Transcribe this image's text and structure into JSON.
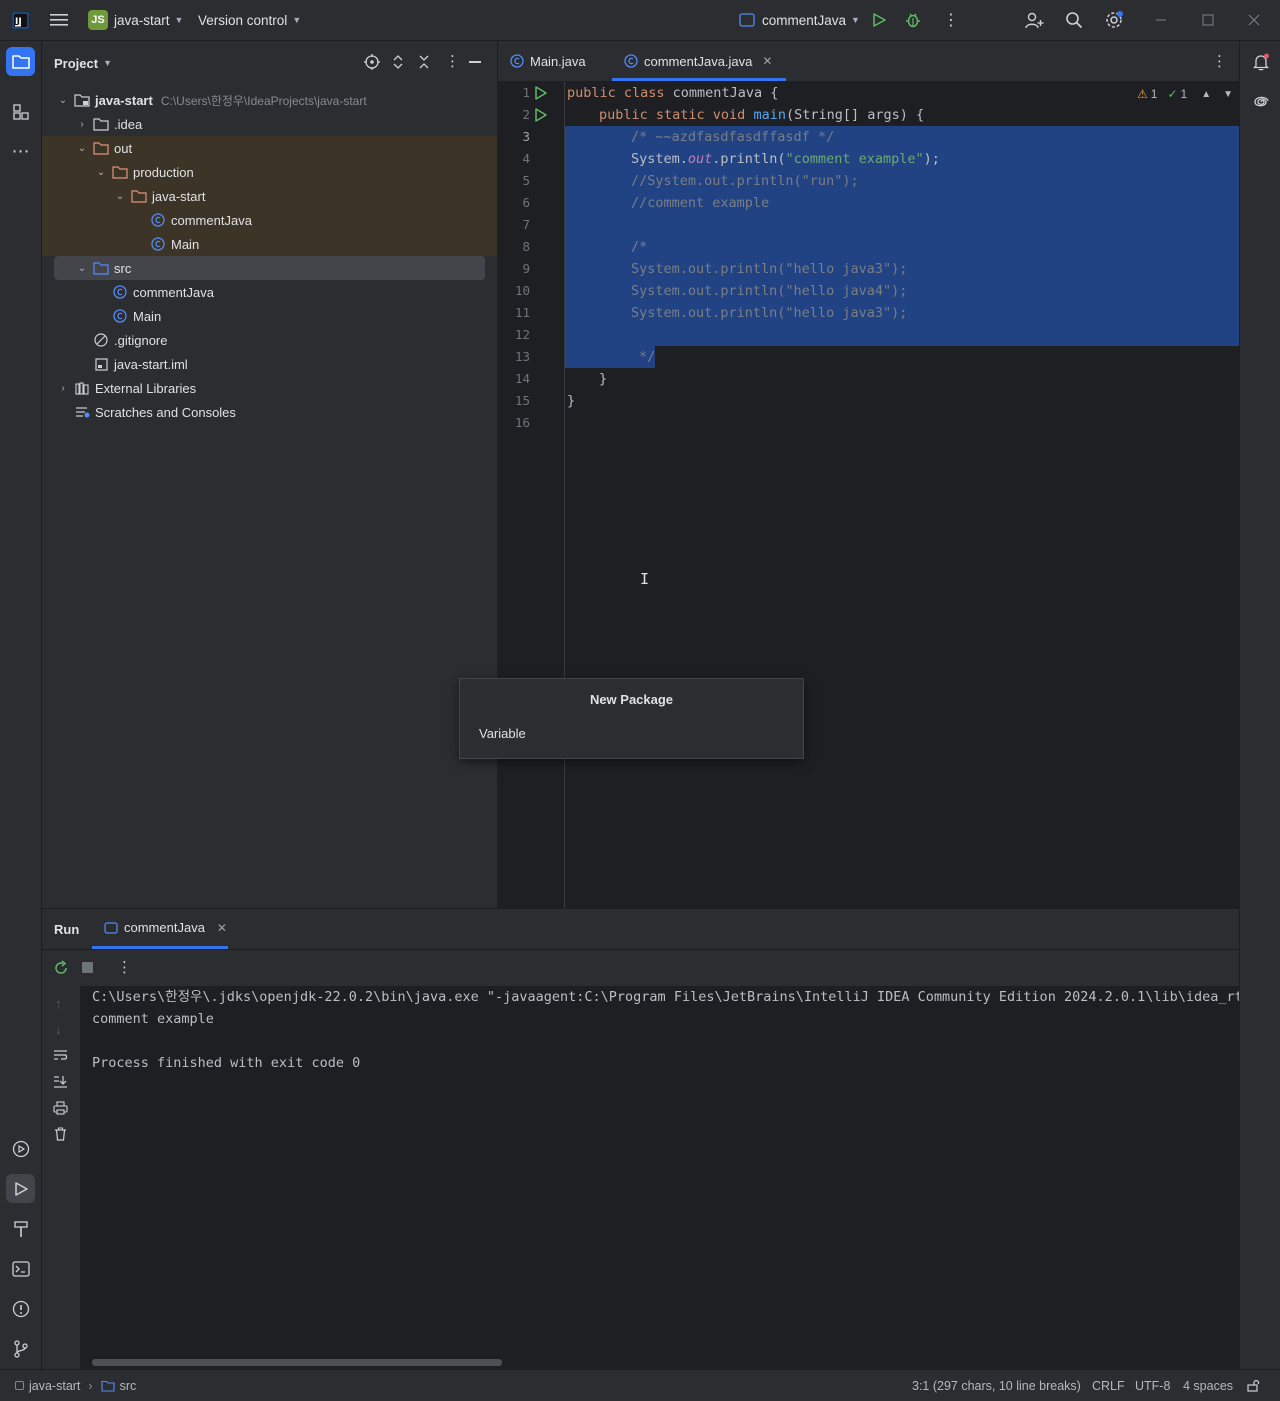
{
  "titlebar": {
    "project_badge": "JS",
    "project_name": "java-start",
    "vcs_label": "Version control",
    "run_config": "commentJava"
  },
  "project_panel": {
    "title": "Project",
    "tree": [
      {
        "label": "java-start",
        "hint": "C:\\Users\\한정우\\IdeaProjects\\java-start"
      },
      {
        "label": ".idea"
      },
      {
        "label": "out"
      },
      {
        "label": "production"
      },
      {
        "label": "java-start"
      },
      {
        "label": "commentJava"
      },
      {
        "label": "Main"
      },
      {
        "label": "src"
      },
      {
        "label": "commentJava"
      },
      {
        "label": "Main"
      },
      {
        "label": ".gitignore"
      },
      {
        "label": "java-start.iml"
      },
      {
        "label": "External Libraries"
      },
      {
        "label": "Scratches and Consoles"
      }
    ]
  },
  "editor": {
    "tabs": [
      {
        "label": "Main.java"
      },
      {
        "label": "commentJava.java"
      }
    ],
    "inspection": {
      "warnings": "1",
      "ok": "1"
    },
    "line_numbers": [
      "1",
      "2",
      "3",
      "4",
      "5",
      "6",
      "7",
      "8",
      "9",
      "10",
      "11",
      "12",
      "13",
      "14",
      "15",
      "16"
    ],
    "code": {
      "l1_kw": "public class ",
      "l1_rest": "commentJava {",
      "l2_kw": "public static void ",
      "l2_fn": "main",
      "l2_rest": "(String[] args) {",
      "l3": "/* ~~azdfasdfasdffasdf */",
      "l4_a": "System.",
      "l4_fld": "out",
      "l4_b": ".println(",
      "l4_str": "\"comment example\"",
      "l4_c": ");",
      "l5": "//System.out.println(\"run\");",
      "l6": "//comment example",
      "l8": "/*",
      "l9": "System.out.println(\"hello java3\");",
      "l10": "System.out.println(\"hello java4\");",
      "l11": "System.out.println(\"hello java3\");",
      "l13": "*/",
      "l14": "}",
      "l15": "}"
    }
  },
  "popup": {
    "title": "New Package",
    "item": "Variable"
  },
  "run_panel": {
    "title": "Run",
    "tab": "commentJava",
    "console": [
      "C:\\Users\\한정우\\.jdks\\openjdk-22.0.2\\bin\\java.exe \"-javaagent:C:\\Program Files\\JetBrains\\IntelliJ IDEA Community Edition 2024.2.0.1\\lib\\idea_rt.jar",
      "comment example",
      "",
      "Process finished with exit code 0"
    ]
  },
  "statusbar": {
    "breadcrumb_project": "java-start",
    "breadcrumb_folder": "src",
    "position": "3:1 (297 chars, 10 line breaks)",
    "line_separator": "CRLF",
    "encoding": "UTF-8",
    "indent": "4 spaces"
  }
}
